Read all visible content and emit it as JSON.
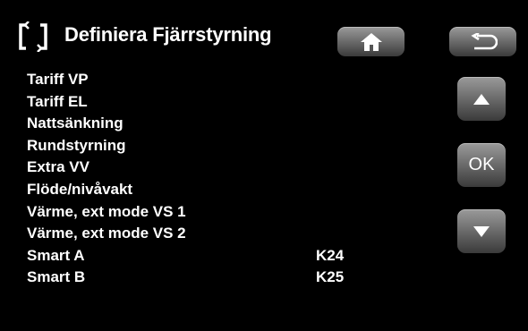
{
  "header": {
    "title": "Definiera Fjärrstyrning",
    "logo_icon": "remote-control-icon",
    "home_icon": "home-icon",
    "back_icon": "back-arrow-icon"
  },
  "nav": {
    "up_icon": "up-arrow-icon",
    "ok_label": "OK",
    "down_icon": "down-arrow-icon"
  },
  "items": [
    {
      "label": "Tariff VP",
      "value": ""
    },
    {
      "label": "Tariff EL",
      "value": ""
    },
    {
      "label": "Nattsänkning",
      "value": ""
    },
    {
      "label": "Rundstyrning",
      "value": ""
    },
    {
      "label": "Extra VV",
      "value": ""
    },
    {
      "label": "Flöde/nivåvakt",
      "value": ""
    },
    {
      "label": "Värme, ext mode VS 1",
      "value": ""
    },
    {
      "label": "Värme, ext mode VS 2",
      "value": ""
    },
    {
      "label": "Smart A",
      "value": "K24"
    },
    {
      "label": "Smart B",
      "value": "K25"
    }
  ],
  "colors": {
    "background": "#000000",
    "text": "#ffffff",
    "button": "#7a7a7a"
  }
}
